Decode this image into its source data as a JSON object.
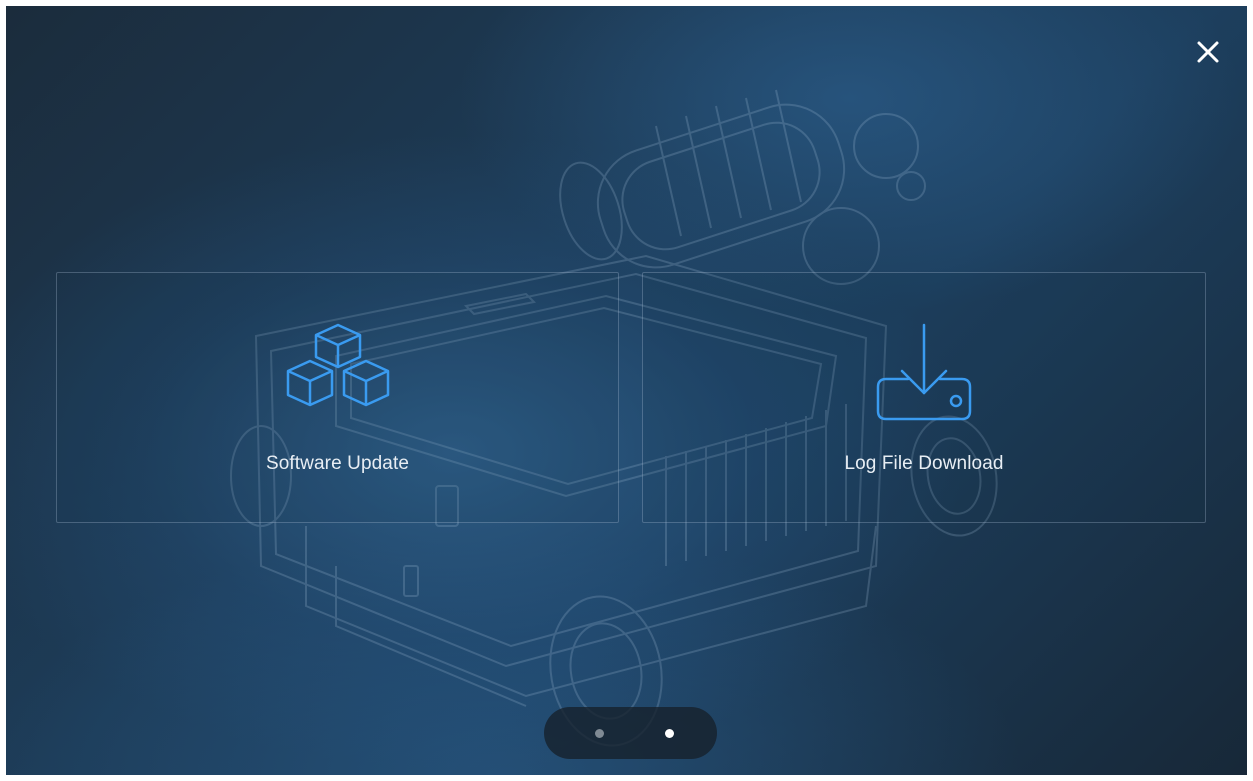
{
  "close_button": {
    "icon": "close-icon"
  },
  "cards": [
    {
      "label": "Software Update",
      "icon": "cubes-icon"
    },
    {
      "label": "Log File Download",
      "icon": "download-to-device-icon"
    }
  ],
  "pager": {
    "total_pages": 2,
    "active_page": 2
  },
  "colors": {
    "accent_blue": "#3a9bf0",
    "background_dark": "#1b2c3c",
    "background_blue": "#1d3f5e",
    "text": "#e8eef4",
    "active_dot": "#ffffff",
    "inactive_dot": "#7f8a94"
  }
}
